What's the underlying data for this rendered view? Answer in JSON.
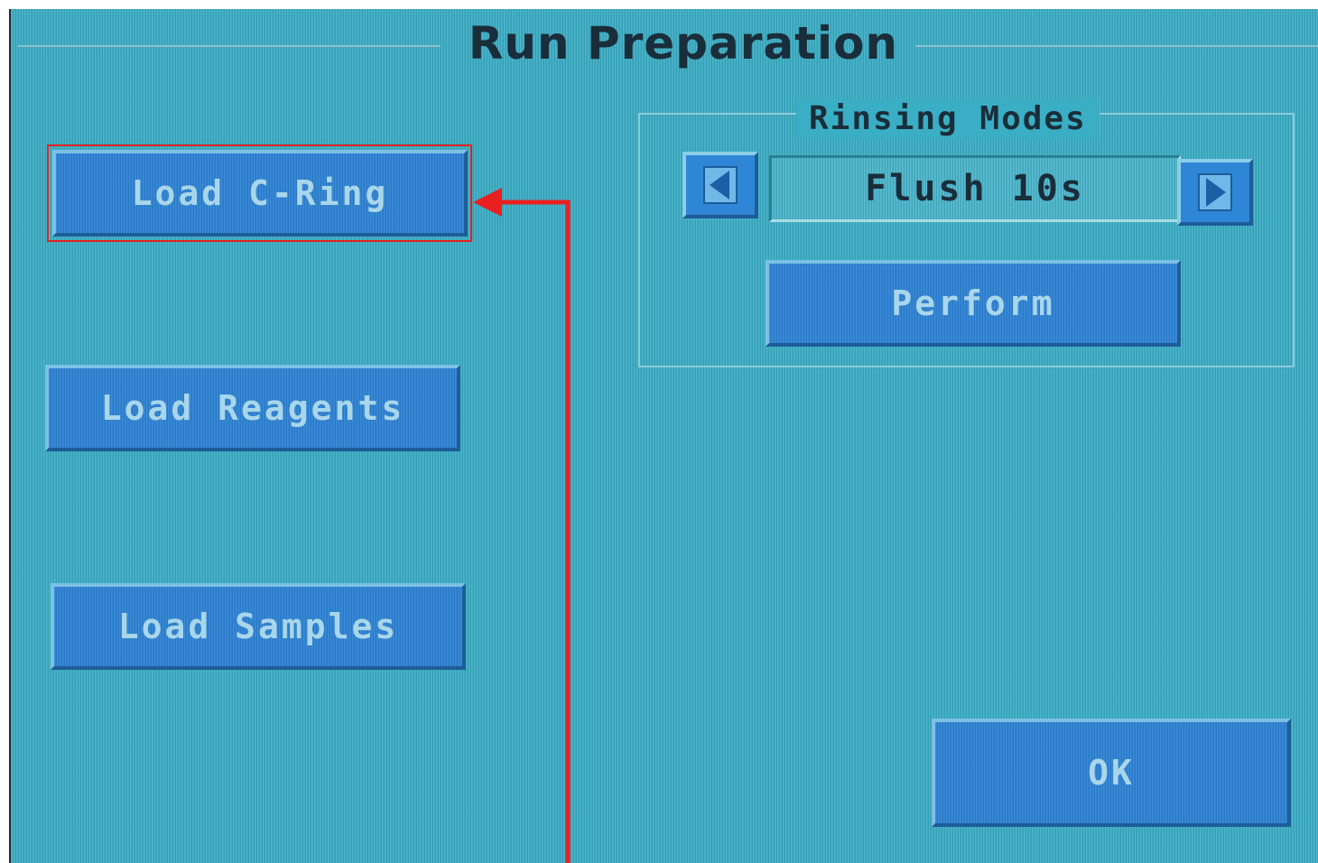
{
  "window": {
    "title": "Run Preparation"
  },
  "left_panel": {
    "buttons": [
      {
        "label": "Load C-Ring"
      },
      {
        "label": "Load Reagents"
      },
      {
        "label": "Load Samples"
      }
    ]
  },
  "rinsing_modes": {
    "group_label": "Rinsing Modes",
    "selected_value": "Flush 10s",
    "prev_icon": "triangle-left-icon",
    "next_icon": "triangle-right-icon",
    "perform_label": "Perform"
  },
  "footer": {
    "ok_label": "OK"
  },
  "annotation": {
    "highlight_color": "#e82020",
    "target": "Load C-Ring"
  }
}
